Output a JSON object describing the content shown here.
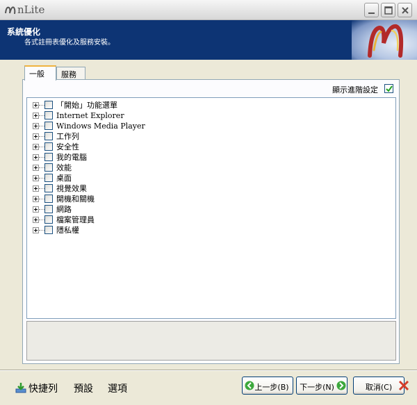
{
  "window": {
    "title": "nLite"
  },
  "banner": {
    "title": "系統優化",
    "description": "各式註冊表優化及服務安裝。"
  },
  "tabs": [
    {
      "label": "一般",
      "active": true
    },
    {
      "label": "服務",
      "active": false
    }
  ],
  "options": {
    "show_advanced_label": "顯示進階設定",
    "show_advanced_checked": true
  },
  "tree": {
    "items": [
      {
        "label": "「開始」功能選單",
        "checked": false
      },
      {
        "label": "Internet Explorer",
        "checked": false
      },
      {
        "label": "Windows Media Player",
        "checked": false
      },
      {
        "label": "工作列",
        "checked": false
      },
      {
        "label": "安全性",
        "checked": false
      },
      {
        "label": "我的電腦",
        "checked": false
      },
      {
        "label": "效能",
        "checked": false
      },
      {
        "label": "桌面",
        "checked": false
      },
      {
        "label": "視覺效果",
        "checked": false
      },
      {
        "label": "開機和關機",
        "checked": false
      },
      {
        "label": "網路",
        "checked": false
      },
      {
        "label": "檔案管理員",
        "checked": false
      },
      {
        "label": "隱私權",
        "checked": false
      }
    ]
  },
  "footer": {
    "shortcut_label": "快捷列",
    "preset_label": "預設",
    "options_label": "選項",
    "back_label": "上一步(B)",
    "next_label": "下一步(N)",
    "cancel_label": "取消(C)"
  },
  "colors": {
    "banner": "#0d3474",
    "tab_highlight": "#f0b33e",
    "cancel_x": "#d23c2a"
  }
}
